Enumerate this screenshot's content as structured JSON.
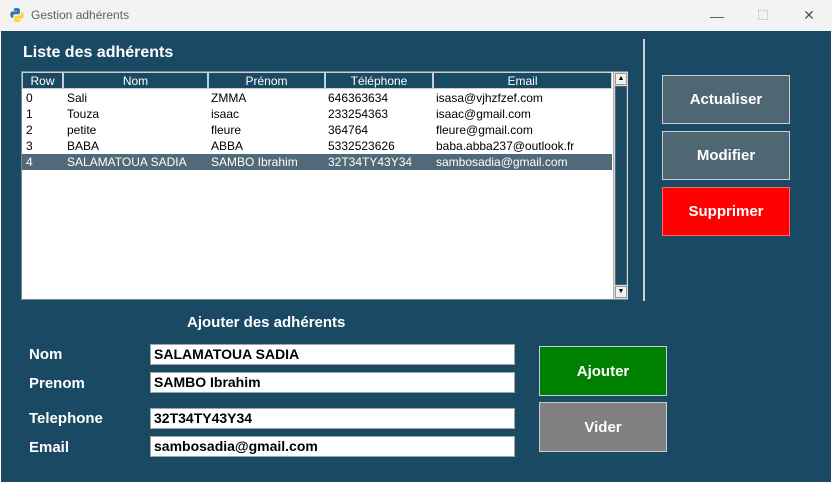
{
  "window": {
    "title": "Gestion adhérents",
    "minimize_glyph": "—",
    "maximize_glyph": "☐",
    "close_glyph": "✕"
  },
  "list": {
    "title": "Liste des adhérents",
    "columns": [
      "Row",
      "Nom",
      "Prénom",
      "Téléphone",
      "Email"
    ],
    "rows": [
      {
        "row": "0",
        "nom": "Sali",
        "prenom": "ZMMA",
        "telephone": "646363634",
        "email": "isasa@vjhzfzef.com"
      },
      {
        "row": "1",
        "nom": "Touza",
        "prenom": "isaac",
        "telephone": "233254363",
        "email": "isaac@gmail.com"
      },
      {
        "row": "2",
        "nom": "petite",
        "prenom": "fleure",
        "telephone": "364764",
        "email": "fleure@gmail.com"
      },
      {
        "row": "3",
        "nom": "BABA",
        "prenom": "ABBA",
        "telephone": "5332523626",
        "email": "baba.abba237@outlook.fr"
      },
      {
        "row": "4",
        "nom": "SALAMATOUA SADIA",
        "prenom": "SAMBO Ibrahim",
        "telephone": "32T34TY43Y34",
        "email": "sambosadia@gmail.com"
      }
    ],
    "selected_index": 4,
    "scroll_up_glyph": "▲",
    "scroll_down_glyph": "▼"
  },
  "side_buttons": {
    "refresh": "Actualiser",
    "modify": "Modifier",
    "delete": "Supprimer"
  },
  "form": {
    "title": "Ajouter des adhérents",
    "labels": {
      "nom": "Nom",
      "prenom": "Prenom",
      "telephone": "Telephone",
      "email": "Email"
    },
    "values": {
      "nom": "SALAMATOUA SADIA",
      "prenom": "SAMBO Ibrahim",
      "telephone": "32T34TY43Y34",
      "email": "sambosadia@gmail.com"
    },
    "add_button": "Ajouter",
    "clear_button": "Vider"
  },
  "colors": {
    "background": "#1a4a63",
    "button_gray_blue": "#4f6673",
    "delete_red": "#ff0000",
    "add_green": "#008000",
    "clear_gray": "#808080",
    "selected_row": "#516979"
  }
}
